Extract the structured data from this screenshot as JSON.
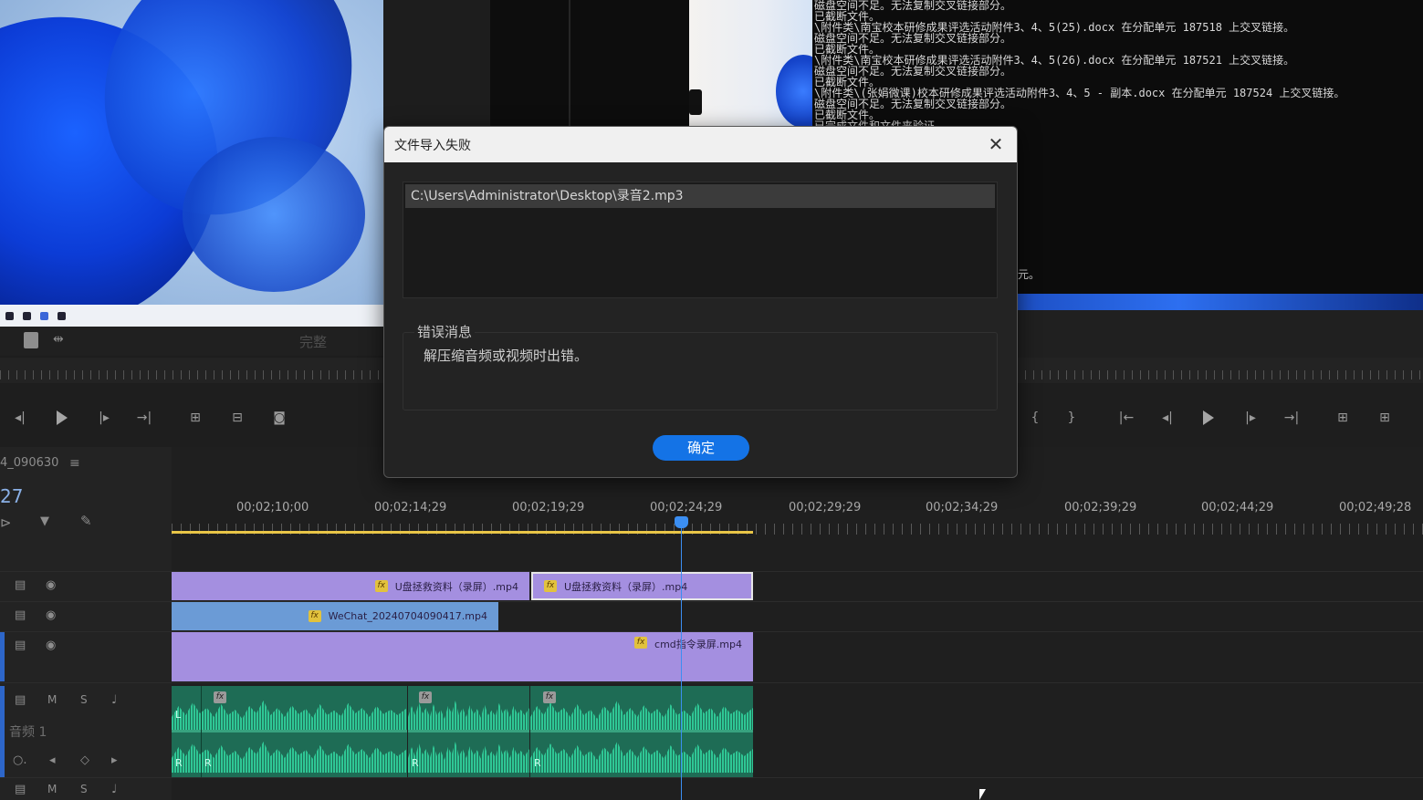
{
  "dialog": {
    "title": "文件导入失败",
    "close_glyph": "✕",
    "file_path": "C:\\Users\\Administrator\\Desktop\\录音2.mp3",
    "error_label": "错误消息",
    "error_text": "解压缩音频或视频时出错。",
    "ok_label": "确定"
  },
  "cmd_lines": [
    "磁盘空间不足。无法复制交叉链接部分。",
    "已截断文件。",
    "\\附件类\\南宝校本研修成果评选活动附件3、4、5(25).docx 在分配单元 187518 上交叉链接。",
    "磁盘空间不足。无法复制交叉链接部分。",
    "已截断文件。",
    "\\附件类\\南宝校本研修成果评选活动附件3、4、5(26).docx 在分配单元 187521 上交叉链接。",
    "磁盘空间不足。无法复制交叉链接部分。",
    "已截断文件。",
    "\\附件类\\(张娟微课)校本研修成果评选活动附件3、4、5 - 副本.docx 在分配单元 187524 上交叉链接。",
    "磁盘空间不足。无法复制交叉链接部分。",
    "已截断文件。",
    "已完成文件和文件夹验证。"
  ],
  "cmd_tail": "元。",
  "source_monitor": {
    "fit_label": "完整"
  },
  "sequence": {
    "name": "4_090630",
    "timecode_partial": "27"
  },
  "ruler_times": [
    "00;02;10;00",
    "00;02;14;29",
    "00;02;19;29",
    "00;02;24;29",
    "00;02;29;29",
    "00;02;34;29",
    "00;02;39;29",
    "00;02;44;29",
    "00;02;49;28"
  ],
  "clips": {
    "v3_a": "U盘拯救资料（录屏）.mp4",
    "v3_b": "U盘拯救资料（录屏）.mp4",
    "v2": "WeChat_20240704090417.mp4",
    "v1": "cmd指令录屏.mp4"
  },
  "audio": {
    "track_label": "音频 1",
    "mute": "M",
    "solo": "S",
    "left_ch": "L",
    "right_ch": "R"
  },
  "colors": {
    "accent": "#1473e6",
    "video_clip": "#a48fe0",
    "video_clip_blue": "#6b9bd6",
    "audio_clip": "#1e6c55",
    "playhead": "#3b8ef2"
  }
}
